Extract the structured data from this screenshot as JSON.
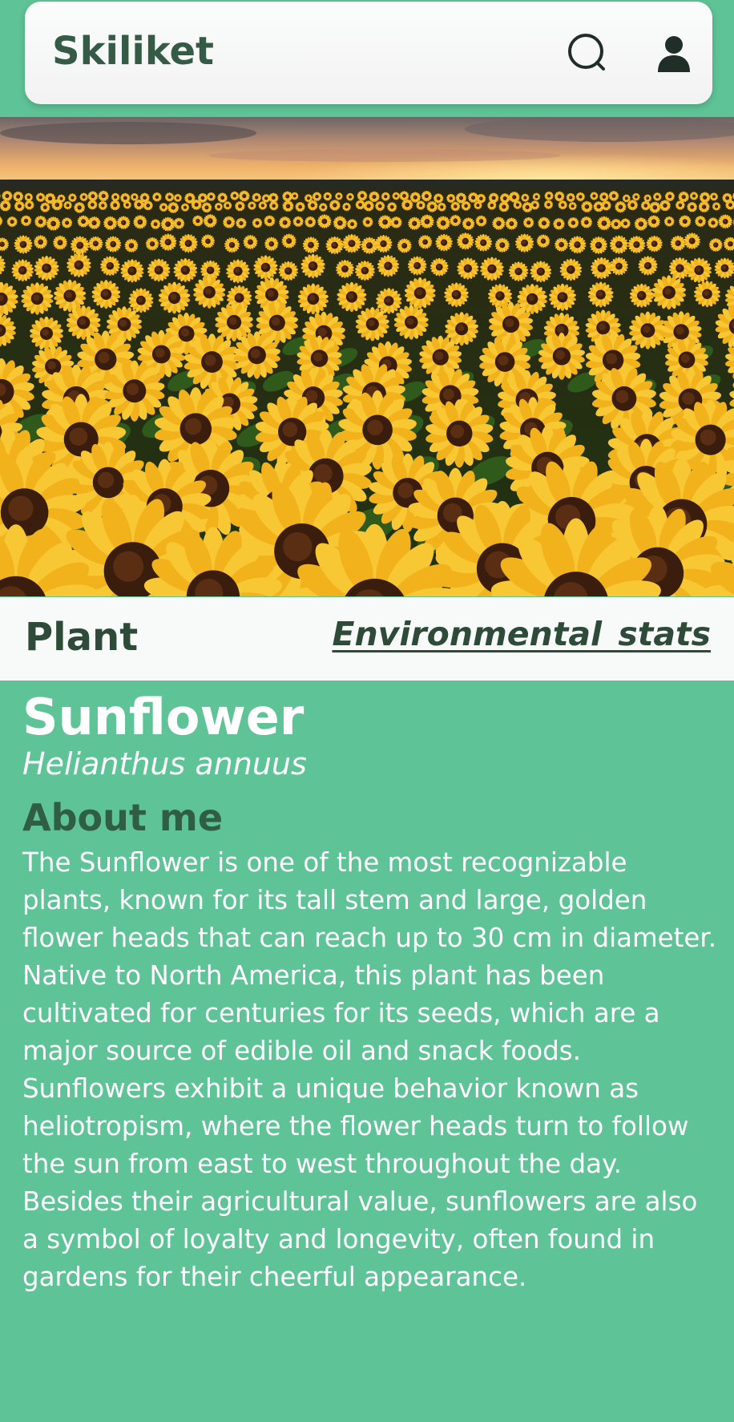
{
  "header": {
    "title": "Skiliket",
    "search_icon": "search-icon",
    "user_icon": "user-icon"
  },
  "hero": {
    "image": "sunflower-field-photo"
  },
  "tabs": {
    "plant_label": "Plant",
    "env_label": "Environmental stats"
  },
  "plant": {
    "common_name": "Sunflower",
    "scientific_name": "Helianthus annuus",
    "about_heading": "About me",
    "about_text": "The Sunflower is one of the most recognizable plants, known for its tall stem and large, golden flower heads that can reach up to 30 cm in diameter. Native to North America, this plant has been cultivated for centuries for its seeds, which are a major source of edible oil and snack foods. Sunflowers exhibit a unique behavior known as heliotropism, where the flower heads turn to follow the sun from east to west throughout the day. Besides their agricultural value, sunflowers are also a symbol of loyalty and longevity, often found in gardens for their cheerful appearance."
  },
  "colors": {
    "background": "#5ec396",
    "header_bg": "#f5f5f5",
    "title_color": "#355a45",
    "heading_dark": "#2d4b38"
  }
}
